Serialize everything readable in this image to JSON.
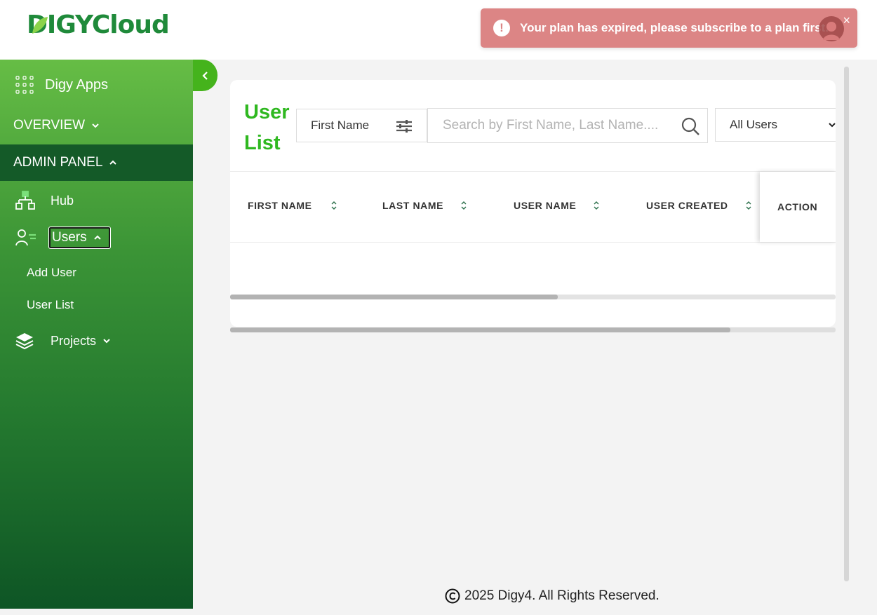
{
  "header": {
    "logo_part1": "DIGY",
    "logo_part2": "Cloud"
  },
  "toast": {
    "message": "Your plan has expired, please subscribe to a plan first.",
    "icon": "alert-circle-icon",
    "close": "×",
    "color": "#dc8585"
  },
  "sidebar": {
    "apps_label": "Digy Apps",
    "overview_label": "OVERVIEW",
    "admin_label": "ADMIN PANEL",
    "hub_label": "Hub",
    "users_label": "Users",
    "add_user_label": "Add User",
    "user_list_label": "User List",
    "projects_label": "Projects"
  },
  "main": {
    "title": "User List",
    "filter_field": "First Name",
    "search_placeholder": "Search by First Name, Last Name....",
    "user_filter": "All Users",
    "columns": [
      "FIRST NAME",
      "LAST NAME",
      "USER NAME",
      "USER CREATED",
      "ACTION"
    ]
  },
  "footer": {
    "text": "2025 Digy4. All Rights Reserved."
  },
  "colors": {
    "accent_green": "#2fb820",
    "sidebar_top": "#66bd45",
    "sidebar_bottom": "#0e5525",
    "admin_bg": "#145a28"
  }
}
